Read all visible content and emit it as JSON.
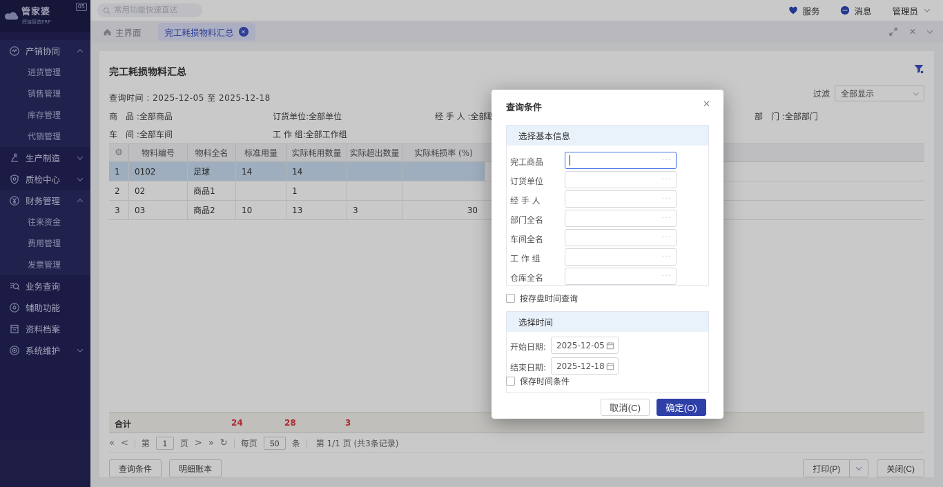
{
  "colors": {
    "accent": "#3b50c0",
    "primary_button": "#2e3fa8",
    "selected_row": "#c9ddf1",
    "total_value_red": "#d9363e",
    "sidebar_bg": "#232358"
  },
  "logo": {
    "brand": "管家婆",
    "sub": "辉煌智造ERP",
    "badge": "05"
  },
  "topbar": {
    "search_placeholder": "常用功能快速直达",
    "service": "服务",
    "message": "消息",
    "user": "管理员"
  },
  "tabbar": {
    "home": "主界面",
    "active_tab": "完工耗损物料汇总",
    "close_icon": "✕"
  },
  "sidebar": {
    "items": [
      {
        "label": "产销协同"
      },
      {
        "label": "进货管理"
      },
      {
        "label": "销售管理"
      },
      {
        "label": "库存管理"
      },
      {
        "label": "代销管理"
      },
      {
        "label": "生产制造"
      },
      {
        "label": "质检中心"
      },
      {
        "label": "财务管理"
      },
      {
        "label": "往来资金"
      },
      {
        "label": "费用管理"
      },
      {
        "label": "发票管理"
      },
      {
        "label": "业务查询"
      },
      {
        "label": "辅助功能"
      },
      {
        "label": "资料档案"
      },
      {
        "label": "系统维护"
      }
    ]
  },
  "page": {
    "title": "完工耗损物料汇总",
    "query_time": "查询时间 : 2025-12-05 至 2025-12-18",
    "filter_label": "过滤",
    "filter_value": "全部显示",
    "filters_row1": [
      "商　品 :全部商品",
      "订货单位:全部单位",
      "经 手 人 :全部职员",
      "部　门 :全部部门"
    ],
    "filters_row2": [
      "车　间 :全部车间",
      "工 作 组:全部工作组"
    ]
  },
  "table": {
    "settings_icon": "⚙",
    "columns": [
      "物料编号",
      "物料全名",
      "标准用量",
      "实际耗用数量",
      "实际超出数量",
      "实际耗损率 (%)"
    ],
    "rows": [
      {
        "cells": [
          "1",
          "0102",
          "足球",
          "14",
          "14",
          "",
          ""
        ]
      },
      {
        "cells": [
          "2",
          "02",
          "商品1",
          "",
          "1",
          "",
          ""
        ]
      },
      {
        "cells": [
          "3",
          "03",
          "商品2",
          "10",
          "13",
          "3",
          "30"
        ]
      }
    ],
    "total_label": "合计",
    "total_standard": "24",
    "total_actual": "28",
    "total_excess": "3"
  },
  "pagination": {
    "first": "«",
    "prev": "<",
    "page_pre": "第",
    "page": "1",
    "page_post": "页",
    "next": ">",
    "last": "»",
    "refresh": "↻",
    "per_pre": "每页",
    "per": "50",
    "per_post": "条",
    "summary": "第 1/1 页 (共3条记录)"
  },
  "footer": {
    "query": "查询条件",
    "detail": "明细账本",
    "print": "打印(P)",
    "close": "关闭(C)"
  },
  "modal": {
    "title": "查询条件",
    "close_icon": "✕",
    "section_basic": "选择基本信息",
    "fields": [
      {
        "label": "完工商品"
      },
      {
        "label": "订货单位"
      },
      {
        "label": "经 手 人"
      },
      {
        "label": "部门全名"
      },
      {
        "label": "车间全名"
      },
      {
        "label": "工 作 组"
      },
      {
        "label": "仓库全名"
      }
    ],
    "ellipsis": "···",
    "checkbox_storage": "按存盘时间查询",
    "section_time": "选择时间",
    "date_start_label": "开始日期:",
    "date_start": "2025-12-05",
    "date_end_label": "结束日期:",
    "date_end": "2025-12-18",
    "checkbox_save": "保存时间条件",
    "cancel": "取消(C)",
    "ok": "确定(O)"
  }
}
